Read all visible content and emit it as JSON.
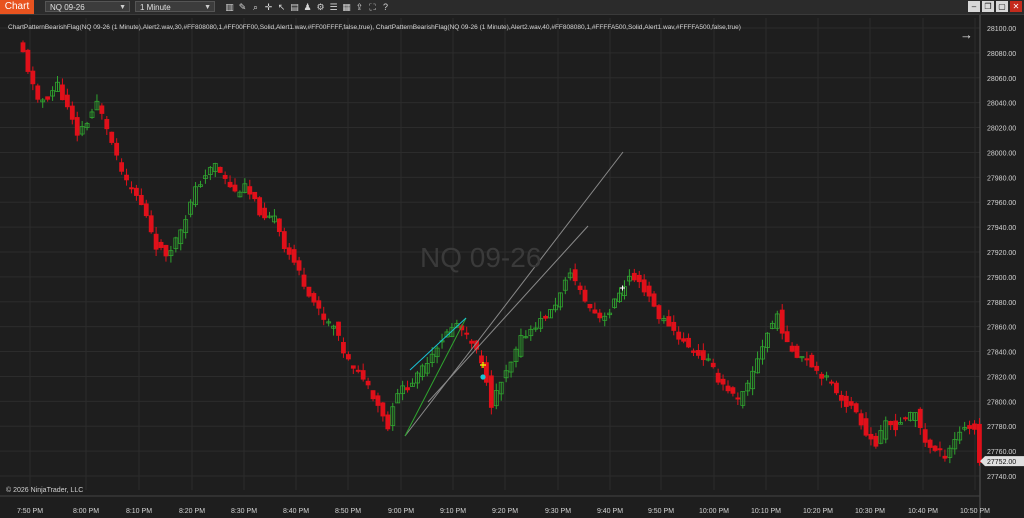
{
  "app": {
    "badge": "Chart"
  },
  "toolbar": {
    "instrument": "NQ 09-26",
    "interval": "1 Minute",
    "icons": [
      "bar-type-icon",
      "draw-tool-icon",
      "zoom-icon",
      "crosshair-icon",
      "pointer-icon",
      "data-box-icon",
      "strategies-icon",
      "indicators-icon",
      "properties-icon",
      "template-icon",
      "share-icon",
      "lock-icon",
      "help-icon"
    ]
  },
  "window": {
    "minimize": "–",
    "restore": "❐",
    "maximize": "▢",
    "close": "✕"
  },
  "indicator_label": "ChartPatternBearishFlag(NQ 09-26 (1 Minute),Alert2.wav,30,#FF808080,1,#FF00FF00,Solid,Alert1.wav,#FF00FFFF,false,true), ChartPatternBearishFlag(NQ 09-26 (1 Minute),Alert2.wav,40,#FF808080,1,#FFFFA500,Solid,Alert1.wav,#FFFFA500,false,true)",
  "nav_arrow": "→",
  "watermark": "NQ 09-26",
  "copyright": "© 2026 NinjaTrader, LLC",
  "colors": {
    "up": "#2fa52f",
    "down": "#e0101a",
    "price_tag": "#e0e0e0",
    "accent": "#e8531f",
    "cyan": "#19c3d6",
    "yellow": "#ffff00"
  },
  "chart_data": {
    "type": "candlestick",
    "instrument": "NQ 09-26",
    "interval": "1 Minute",
    "last_price": "27752.00",
    "ylim": [
      27730,
      28110
    ],
    "y_ticks": [
      "28100.00",
      "28080.00",
      "28060.00",
      "28040.00",
      "28020.00",
      "28000.00",
      "27980.00",
      "27960.00",
      "27940.00",
      "27920.00",
      "27900.00",
      "27880.00",
      "27860.00",
      "27840.00",
      "27820.00",
      "27800.00",
      "27780.00",
      "27760.00",
      "27740.00"
    ],
    "x_ticks": [
      "7:50 PM",
      "8:00 PM",
      "8:10 PM",
      "8:20 PM",
      "8:30 PM",
      "8:40 PM",
      "8:50 PM",
      "9:00 PM",
      "9:10 PM",
      "9:20 PM",
      "9:30 PM",
      "9:40 PM",
      "9:50 PM",
      "10:00 PM",
      "10:10 PM",
      "10:20 PM",
      "10:30 PM",
      "10:40 PM",
      "10:50 PM"
    ],
    "close_path": [
      [
        0,
        28080
      ],
      [
        3,
        28040
      ],
      [
        5,
        28045
      ],
      [
        7,
        28055
      ],
      [
        9,
        28035
      ],
      [
        11,
        28015
      ],
      [
        13,
        28025
      ],
      [
        15,
        28040
      ],
      [
        17,
        28020
      ],
      [
        19,
        27995
      ],
      [
        21,
        27975
      ],
      [
        23,
        27965
      ],
      [
        25,
        27950
      ],
      [
        27,
        27925
      ],
      [
        29,
        27918
      ],
      [
        31,
        27930
      ],
      [
        33,
        27948
      ],
      [
        35,
        27970
      ],
      [
        37,
        27982
      ],
      [
        39,
        27990
      ],
      [
        41,
        27978
      ],
      [
        43,
        27968
      ],
      [
        45,
        27972
      ],
      [
        47,
        27960
      ],
      [
        49,
        27945
      ],
      [
        51,
        27950
      ],
      [
        53,
        27925
      ],
      [
        55,
        27912
      ],
      [
        57,
        27895
      ],
      [
        59,
        27880
      ],
      [
        61,
        27865
      ],
      [
        63,
        27860
      ],
      [
        65,
        27840
      ],
      [
        67,
        27825
      ],
      [
        69,
        27820
      ],
      [
        71,
        27805
      ],
      [
        73,
        27790
      ],
      [
        74,
        27778
      ],
      [
        75,
        27798
      ],
      [
        76,
        27808
      ],
      [
        78,
        27812
      ],
      [
        80,
        27820
      ],
      [
        82,
        27833
      ],
      [
        84,
        27845
      ],
      [
        86,
        27855
      ],
      [
        88,
        27862
      ],
      [
        90,
        27852
      ],
      [
        92,
        27840
      ],
      [
        94,
        27818
      ],
      [
        95,
        27798
      ],
      [
        97,
        27815
      ],
      [
        99,
        27830
      ],
      [
        101,
        27850
      ],
      [
        103,
        27858
      ],
      [
        105,
        27865
      ],
      [
        107,
        27872
      ],
      [
        109,
        27886
      ],
      [
        111,
        27905
      ],
      [
        113,
        27888
      ],
      [
        115,
        27875
      ],
      [
        117,
        27868
      ],
      [
        119,
        27872
      ],
      [
        121,
        27888
      ],
      [
        123,
        27900
      ],
      [
        125,
        27895
      ],
      [
        127,
        27885
      ],
      [
        129,
        27868
      ],
      [
        131,
        27862
      ],
      [
        133,
        27852
      ],
      [
        135,
        27843
      ],
      [
        137,
        27838
      ],
      [
        139,
        27832
      ],
      [
        141,
        27818
      ],
      [
        143,
        27810
      ],
      [
        145,
        27800
      ],
      [
        147,
        27812
      ],
      [
        149,
        27835
      ],
      [
        151,
        27855
      ],
      [
        153,
        27870
      ],
      [
        155,
        27845
      ],
      [
        157,
        27838
      ],
      [
        159,
        27835
      ],
      [
        161,
        27825
      ],
      [
        163,
        27818
      ],
      [
        165,
        27808
      ],
      [
        167,
        27798
      ],
      [
        169,
        27792
      ],
      [
        171,
        27775
      ],
      [
        173,
        27765
      ],
      [
        175,
        27782
      ],
      [
        177,
        27780
      ],
      [
        179,
        27787
      ],
      [
        181,
        27790
      ],
      [
        183,
        27768
      ],
      [
        185,
        27760
      ],
      [
        187,
        27757
      ],
      [
        189,
        27770
      ],
      [
        191,
        27780
      ],
      [
        193,
        27778
      ],
      [
        194,
        27752
      ]
    ]
  }
}
